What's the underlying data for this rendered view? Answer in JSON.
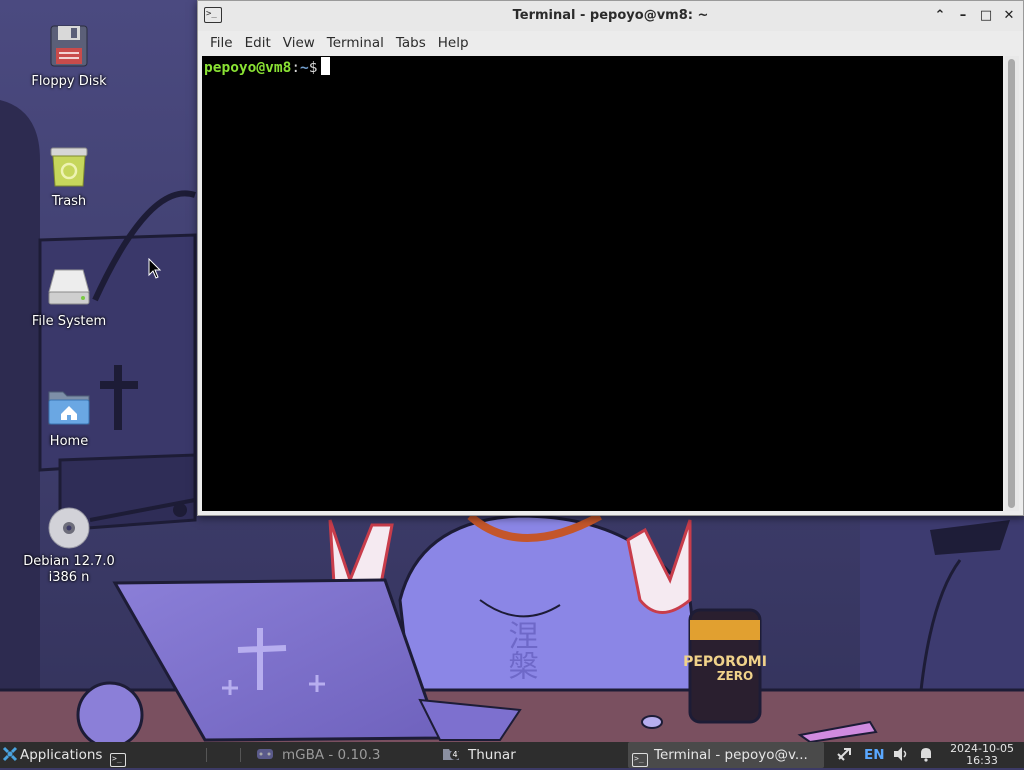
{
  "desktop": {
    "icons": [
      {
        "label": "Floppy Disk",
        "icon": "floppy-disk-icon"
      },
      {
        "label": "Trash",
        "icon": "trash-icon"
      },
      {
        "label": "File System",
        "icon": "drive-icon"
      },
      {
        "label": "Home",
        "icon": "home-folder-icon"
      },
      {
        "label": "Debian 12.7.0 i386 n",
        "icon": "optical-disc-icon"
      }
    ]
  },
  "wallpaper": {
    "can_text_line1": "PEPOROMI",
    "can_text_line2": "ZERO",
    "hoodie_text": "涅槃"
  },
  "terminal": {
    "title": "Terminal - pepoyo@vm8: ~",
    "app_icon_glyph": ">_",
    "controls": {
      "keep_above": "⌃",
      "minimize": "–",
      "maximize": "□",
      "close": "✕"
    },
    "menu": [
      "File",
      "Edit",
      "View",
      "Terminal",
      "Tabs",
      "Help"
    ],
    "prompt": {
      "user_host": "pepoyo@vm8",
      "sep": ":",
      "path": "~",
      "symbol": "$"
    },
    "colors": {
      "user": "#8ae234",
      "path": "#729fcf",
      "background": "#000000"
    }
  },
  "panel": {
    "applications_label": "Applications",
    "quick_launch_glyph": ">_",
    "tasks": [
      {
        "label": "mGBA - 0.10.3",
        "state": "minimized"
      },
      {
        "label": "Thunar",
        "badge": "4",
        "state": "normal"
      },
      {
        "label": "Terminal - pepoyo@v...",
        "state": "active"
      }
    ],
    "tray": {
      "language": "EN"
    },
    "clock": {
      "date": "2024-10-05",
      "time": "16:33"
    }
  }
}
